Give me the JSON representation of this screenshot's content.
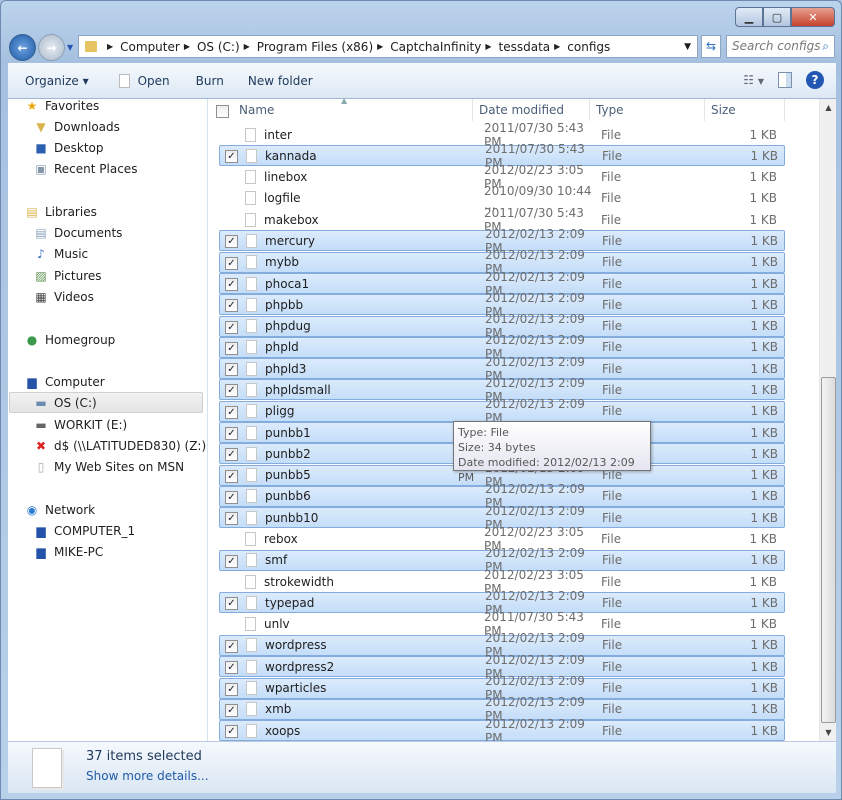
{
  "window": {
    "minimize": "▁",
    "maximize": "▢",
    "close": "✕"
  },
  "address": {
    "crumbs": [
      "Computer",
      "OS (C:)",
      "Program Files (x86)",
      "CaptchaInfinity",
      "tessdata",
      "configs"
    ],
    "search_placeholder": "Search configs"
  },
  "toolbar": {
    "organize": "Organize ▾",
    "open": "Open",
    "burn": "Burn",
    "new_folder": "New folder"
  },
  "nav": {
    "items": [
      {
        "label": "Favorites",
        "icon": "star-icon",
        "glyph": "★",
        "color": "#e9a915",
        "level": 0
      },
      {
        "label": "Downloads",
        "icon": "downloads-folder-icon",
        "glyph": "▼",
        "color": "#d9b44a",
        "level": 1
      },
      {
        "label": "Desktop",
        "icon": "desktop-icon",
        "glyph": "■",
        "color": "#2b5fb0",
        "level": 1
      },
      {
        "label": "Recent Places",
        "icon": "recent-places-icon",
        "glyph": "▣",
        "color": "#8796ab",
        "level": 1
      },
      {
        "label": "Libraries",
        "icon": "libraries-icon",
        "glyph": "▤",
        "color": "#d9b44a",
        "level": 0
      },
      {
        "label": "Documents",
        "icon": "documents-icon",
        "glyph": "▤",
        "color": "#8aa0bc",
        "level": 1
      },
      {
        "label": "Music",
        "icon": "music-icon",
        "glyph": "♪",
        "color": "#3b6fc4",
        "level": 1
      },
      {
        "label": "Pictures",
        "icon": "pictures-icon",
        "glyph": "▨",
        "color": "#5a8d4a",
        "level": 1
      },
      {
        "label": "Videos",
        "icon": "videos-icon",
        "glyph": "▦",
        "color": "#444",
        "level": 1
      },
      {
        "label": "Homegroup",
        "icon": "homegroup-icon",
        "glyph": "●",
        "color": "#3a9a4a",
        "level": 0
      },
      {
        "label": "Computer",
        "icon": "computer-icon",
        "glyph": "▆",
        "color": "#2452a8",
        "level": 0
      },
      {
        "label": "OS (C:)",
        "icon": "drive-c-icon",
        "glyph": "▬",
        "color": "#6a8bb0",
        "level": 1,
        "selected": true
      },
      {
        "label": "WORKIT (E:)",
        "icon": "removable-drive-icon",
        "glyph": "▬",
        "color": "#666",
        "level": 1
      },
      {
        "label": "d$ (\\\\LATITUDED830) (Z:)",
        "icon": "disconnected-drive-icon",
        "glyph": "✖",
        "color": "#d22",
        "level": 1
      },
      {
        "label": "My Web Sites on MSN",
        "icon": "document-icon",
        "glyph": "▯",
        "color": "#aaa",
        "level": 1
      },
      {
        "label": "Network",
        "icon": "network-icon",
        "glyph": "◉",
        "color": "#2b7bd0",
        "level": 0
      },
      {
        "label": "COMPUTER_1",
        "icon": "network-computer-icon",
        "glyph": "▆",
        "color": "#2452a8",
        "level": 1
      },
      {
        "label": "MIKE-PC",
        "icon": "network-computer-icon",
        "glyph": "▆",
        "color": "#2452a8",
        "level": 1
      }
    ]
  },
  "columns": {
    "name": "Name",
    "date": "Date modified",
    "type": "Type",
    "size": "Size"
  },
  "files": [
    {
      "name": "inter",
      "date": "2011/07/30 5:43 PM",
      "type": "File",
      "size": "1 KB",
      "selected": false
    },
    {
      "name": "kannada",
      "date": "2011/07/30 5:43 PM",
      "type": "File",
      "size": "1 KB",
      "selected": true
    },
    {
      "name": "linebox",
      "date": "2012/02/23 3:05 PM",
      "type": "File",
      "size": "1 KB",
      "selected": false
    },
    {
      "name": "logfile",
      "date": "2010/09/30 10:44 ...",
      "type": "File",
      "size": "1 KB",
      "selected": false
    },
    {
      "name": "makebox",
      "date": "2011/07/30 5:43 PM",
      "type": "File",
      "size": "1 KB",
      "selected": false
    },
    {
      "name": "mercury",
      "date": "2012/02/13 2:09 PM",
      "type": "File",
      "size": "1 KB",
      "selected": true
    },
    {
      "name": "mybb",
      "date": "2012/02/13 2:09 PM",
      "type": "File",
      "size": "1 KB",
      "selected": true
    },
    {
      "name": "phoca1",
      "date": "2012/02/13 2:09 PM",
      "type": "File",
      "size": "1 KB",
      "selected": true
    },
    {
      "name": "phpbb",
      "date": "2012/02/13 2:09 PM",
      "type": "File",
      "size": "1 KB",
      "selected": true
    },
    {
      "name": "phpdug",
      "date": "2012/02/13 2:09 PM",
      "type": "File",
      "size": "1 KB",
      "selected": true
    },
    {
      "name": "phpld",
      "date": "2012/02/13 2:09 PM",
      "type": "File",
      "size": "1 KB",
      "selected": true
    },
    {
      "name": "phpld3",
      "date": "2012/02/13 2:09 PM",
      "type": "File",
      "size": "1 KB",
      "selected": true
    },
    {
      "name": "phpldsmall",
      "date": "2012/02/13 2:09 PM",
      "type": "File",
      "size": "1 KB",
      "selected": true
    },
    {
      "name": "pligg",
      "date": "2012/02/13 2:09 PM",
      "type": "File",
      "size": "1 KB",
      "selected": true
    },
    {
      "name": "punbb1",
      "date": "2012/02/13 2:09 PM",
      "type": "File",
      "size": "1 KB",
      "selected": true
    },
    {
      "name": "punbb2",
      "date": "2012/02/13 2:09 PM",
      "type": "File",
      "size": "1 KB",
      "selected": true
    },
    {
      "name": "punbb5",
      "date": "2012/02/13 2:09 PM",
      "type": "File",
      "size": "1 KB",
      "selected": true
    },
    {
      "name": "punbb6",
      "date": "2012/02/13 2:09 PM",
      "type": "File",
      "size": "1 KB",
      "selected": true
    },
    {
      "name": "punbb10",
      "date": "2012/02/13 2:09 PM",
      "type": "File",
      "size": "1 KB",
      "selected": true
    },
    {
      "name": "rebox",
      "date": "2012/02/23 3:05 PM",
      "type": "File",
      "size": "1 KB",
      "selected": false
    },
    {
      "name": "smf",
      "date": "2012/02/13 2:09 PM",
      "type": "File",
      "size": "1 KB",
      "selected": true
    },
    {
      "name": "strokewidth",
      "date": "2012/02/23 3:05 PM",
      "type": "File",
      "size": "1 KB",
      "selected": false
    },
    {
      "name": "typepad",
      "date": "2012/02/13 2:09 PM",
      "type": "File",
      "size": "1 KB",
      "selected": true
    },
    {
      "name": "unlv",
      "date": "2011/07/30 5:43 PM",
      "type": "File",
      "size": "1 KB",
      "selected": false
    },
    {
      "name": "wordpress",
      "date": "2012/02/13 2:09 PM",
      "type": "File",
      "size": "1 KB",
      "selected": true
    },
    {
      "name": "wordpress2",
      "date": "2012/02/13 2:09 PM",
      "type": "File",
      "size": "1 KB",
      "selected": true
    },
    {
      "name": "wparticles",
      "date": "2012/02/13 2:09 PM",
      "type": "File",
      "size": "1 KB",
      "selected": true
    },
    {
      "name": "xmb",
      "date": "2012/02/13 2:09 PM",
      "type": "File",
      "size": "1 KB",
      "selected": true
    },
    {
      "name": "xoops",
      "date": "2012/02/13 2:09 PM",
      "type": "File",
      "size": "1 KB",
      "selected": true
    }
  ],
  "tooltip": {
    "type": "Type: File",
    "size": "Size: 34 bytes",
    "date": "Date modified: 2012/02/13 2:09 PM"
  },
  "details": {
    "count": "37 items selected",
    "more": "Show more details..."
  }
}
